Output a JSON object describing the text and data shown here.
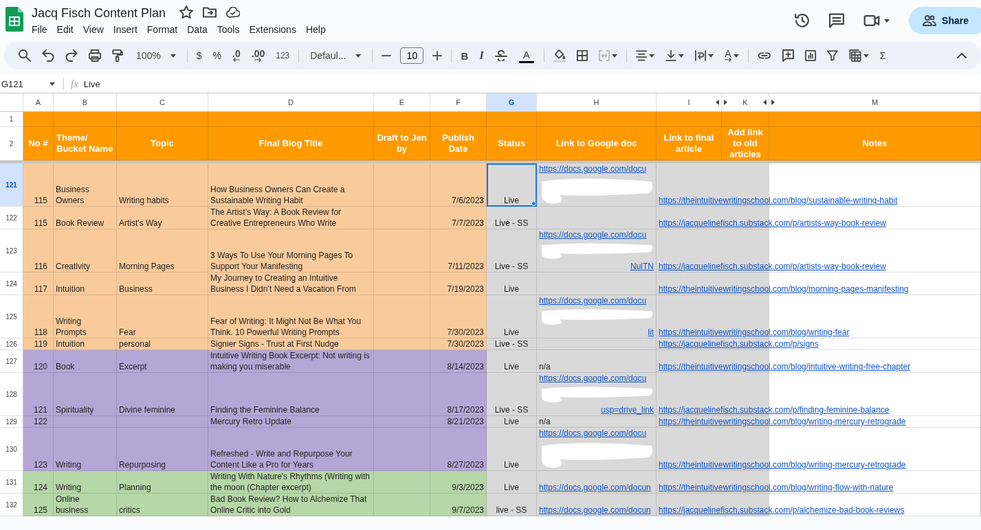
{
  "document": {
    "title": "Jacq Fisch Content Plan"
  },
  "menu": [
    "File",
    "Edit",
    "View",
    "Insert",
    "Format",
    "Data",
    "Tools",
    "Extensions",
    "Help"
  ],
  "share_button": {
    "label": "Share"
  },
  "toolbar": [
    {
      "kind": "search"
    },
    {
      "kind": "undo"
    },
    {
      "kind": "redo"
    },
    {
      "kind": "print"
    },
    {
      "kind": "paintformat"
    },
    {
      "kind": "dropdown",
      "label": "100%"
    },
    {
      "kind": "separator"
    },
    {
      "kind": "text",
      "label": "$"
    },
    {
      "kind": "text",
      "label": "%"
    },
    {
      "kind": "decrease",
      "label": ".0"
    },
    {
      "kind": "increase",
      "label": ".00"
    },
    {
      "kind": "small",
      "label": "123"
    },
    {
      "kind": "separator"
    },
    {
      "kind": "dropdown",
      "label": "Defaul..."
    },
    {
      "kind": "separator"
    },
    {
      "kind": "minus"
    },
    {
      "kind": "field",
      "value": "10"
    },
    {
      "kind": "plus"
    },
    {
      "kind": "separator"
    },
    {
      "kind": "bold",
      "label": "B"
    },
    {
      "kind": "italic",
      "label": "I"
    },
    {
      "kind": "strikethrough"
    },
    {
      "kind": "textcolor",
      "label": "A"
    },
    {
      "kind": "separator"
    },
    {
      "kind": "fill"
    },
    {
      "kind": "borders"
    },
    {
      "kind": "merge"
    },
    {
      "kind": "separator"
    },
    {
      "kind": "align"
    },
    {
      "kind": "valign"
    },
    {
      "kind": "wrap"
    },
    {
      "kind": "rotate",
      "label": "A"
    },
    {
      "kind": "separator"
    },
    {
      "kind": "link"
    },
    {
      "kind": "comment"
    },
    {
      "kind": "chart"
    },
    {
      "kind": "filter"
    },
    {
      "kind": "views"
    },
    {
      "kind": "text",
      "label": "Σ"
    },
    {
      "kind": "collapse"
    }
  ],
  "formula_bar": {
    "cell": "G121",
    "fx": "fx",
    "value": "Live"
  },
  "columns": [
    {
      "letter": "A",
      "selected": false,
      "hidden_left": false,
      "hidden_right": false
    },
    {
      "letter": "B",
      "selected": false,
      "hidden_left": false,
      "hidden_right": false
    },
    {
      "letter": "C",
      "selected": false,
      "hidden_left": false,
      "hidden_right": false
    },
    {
      "letter": "D",
      "selected": false,
      "hidden_left": false,
      "hidden_right": false
    },
    {
      "letter": "E",
      "selected": false,
      "hidden_left": false,
      "hidden_right": false
    },
    {
      "letter": "F",
      "selected": false,
      "hidden_left": false,
      "hidden_right": false
    },
    {
      "letter": "G",
      "selected": true,
      "hidden_left": false,
      "hidden_right": false
    },
    {
      "letter": "H",
      "selected": false,
      "hidden_left": false,
      "hidden_right": false
    },
    {
      "letter": "I",
      "selected": false,
      "hidden_left": false,
      "hidden_right": true
    },
    {
      "letter": "K",
      "selected": false,
      "hidden_left": true,
      "hidden_right": true
    },
    {
      "letter": "M",
      "selected": false,
      "hidden_left": true,
      "hidden_right": false
    }
  ],
  "header_rows": [
    {
      "number": "1"
    },
    {
      "number": "2"
    }
  ],
  "headings": [
    "No #",
    "Theme/\nBucket Name",
    "Topic",
    "Final Blog Title",
    "Draft to Jen\nby",
    "Publish\nDate",
    "Status",
    "Link to Google doc",
    "Link to final\narticle",
    "Add link\nto old\narticles",
    "Notes"
  ],
  "rows": [
    {
      "number": "121",
      "selected": true,
      "color": "#f9cb9c",
      "no": "115",
      "theme": "Business\nOwners",
      "topic": "Writing habits",
      "title": "How Business Owners Can Create a Sustainable Writing Habit",
      "date": "7/6/2023",
      "status": "Live",
      "doc_link": {
        "kind": "redacted",
        "lines": [
          "https://docs.google.com/docu"
        ]
      },
      "final_link": "https://theintuitivewritingschool.com/blog/sustainable-writing-habit"
    },
    {
      "number": "122",
      "selected": false,
      "color": "#f9cb9c",
      "no": "115",
      "theme": "Book Review",
      "topic": "Artist's Way",
      "title": "The Artist’s Way: A Book Review for Creative Entrepreneurs Who Write",
      "date": "7/7/2023",
      "status": "Live - SS",
      "final_link": "https://jacquelinefisch.substack.com/p/artists-way-book-review"
    },
    {
      "number": "123",
      "selected": false,
      "color": "#f9cb9c",
      "no": "116",
      "theme": "Creativity",
      "topic": "Morning Pages",
      "title": "3 Ways To Use Your Morning Pages To Support Your Manifesting",
      "date": "7/11/2023",
      "status": "Live - SS",
      "doc_link": {
        "kind": "redacted",
        "lines": [
          "https://docs.google.com/docu",
          "NulTN"
        ]
      },
      "final_link": "https://jacquelinefisch.substack.com/p/artists-way-book-review"
    },
    {
      "number": "124",
      "selected": false,
      "color": "#f9cb9c",
      "no": "117",
      "theme": "Intuition",
      "topic": "Business",
      "title": "My Journey to Creating an Intuitive Business I Didn’t Need a Vacation From",
      "date": "7/19/2023",
      "status": "Live",
      "final_link": "https://theintuitivewritingschool.com/blog/morning-pages-manifesting"
    },
    {
      "number": "125",
      "selected": false,
      "color": "#f9cb9c",
      "no": "118",
      "theme": "Writing\nPrompts",
      "topic": "Fear",
      "title": "Fear of Writing: It Might Not Be What You Think. 10 Powerful Writing Prompts",
      "date": "7/30/2023",
      "status": "Live",
      "doc_link": {
        "kind": "redacted",
        "lines": [
          "https://docs.google.com/docu",
          "lit"
        ]
      },
      "final_link": "https://theintuitivewritingschool.com/blog/writing-fear"
    },
    {
      "number": "126",
      "selected": false,
      "color": "#f9cb9c",
      "no": "119",
      "theme": "Intuition",
      "topic": "personal",
      "title": "Signier Signs - Trust at First Nudge",
      "date": "7/30/2023",
      "status": "Live - SS",
      "final_link": "https://jacquelinefisch.substack.com/p/signs"
    },
    {
      "number": "127",
      "selected": false,
      "color": "#b4a7d6",
      "no": "120",
      "theme": "Book",
      "topic": "Excerpt",
      "title": "Intuitive Writing Book Excerpt: Not writing is making you miserable",
      "date": "8/14/2023",
      "status": "Live",
      "doc_link": {
        "kind": "plain",
        "lines": [
          "n/a"
        ]
      },
      "final_link": "https://theintuitivewritingschool.com/blog/intuitive-writing-free-chapter"
    },
    {
      "number": "128",
      "selected": false,
      "color": "#b4a7d6",
      "no": "121",
      "theme": "Spirituality",
      "topic": "Divine feminine",
      "title": "Finding the Feminine Balance",
      "date": "8/17/2023",
      "status": "Live - SS",
      "doc_link": {
        "kind": "redacted",
        "lines": [
          "https://docs.google.com/docu",
          "usp=drive_link"
        ]
      },
      "final_link": "https://jacquelinefisch.substack.com/p/finding-feminine-balance"
    },
    {
      "number": "129",
      "selected": false,
      "color": "#b4a7d6",
      "no": "122",
      "title": "Mercury Retro Update",
      "date": "8/21/2023",
      "status": "Live",
      "doc_link": {
        "kind": "plain",
        "lines": [
          "n/a"
        ]
      },
      "final_link": "https://theintuitivewritingschool.com/blog/writing-mercury-retrograde"
    },
    {
      "number": "130",
      "selected": false,
      "color": "#b4a7d6",
      "no": "123",
      "theme": "Writing",
      "topic": "Repurposing",
      "title": "Refreshed - Write and Repurpose Your Content Like a Pro for Years",
      "date": "8/27/2023",
      "status": "Live",
      "doc_link": {
        "kind": "redacted",
        "lines": [
          "https://docs.google.com/docu"
        ]
      },
      "final_link": "https://theintuitivewritingschool.com/blog/writing-mercury-retrograde"
    },
    {
      "number": "131",
      "selected": false,
      "color": "#b6d7a8",
      "no": "124",
      "theme": "Writing",
      "topic": "Planning",
      "title": "Writing With Nature's Rhythms (Writing with the moon (Chapter excerpt)",
      "date": "9/3/2023",
      "status": "Live",
      "doc_link": {
        "kind": "link",
        "lines": [
          "https://docs.google.com/docun"
        ]
      },
      "final_link": "https://theintuitivewritingschool.com/blog/writing-flow-with-nature"
    },
    {
      "number": "132",
      "selected": false,
      "color": "#b6d7a8",
      "no": "125",
      "theme": "Online business",
      "topic": "critics",
      "title": "Bad Book Review? How to Alchemize That Online Critic into Gold",
      "date": "9/7/2023",
      "status": "live - SS",
      "doc_link": {
        "kind": "link",
        "lines": [
          "https://docs.google.com/docun"
        ]
      },
      "final_link": "https://jacquelinefisch.substack.com/p/alchemize-bad-book-reviews"
    }
  ]
}
